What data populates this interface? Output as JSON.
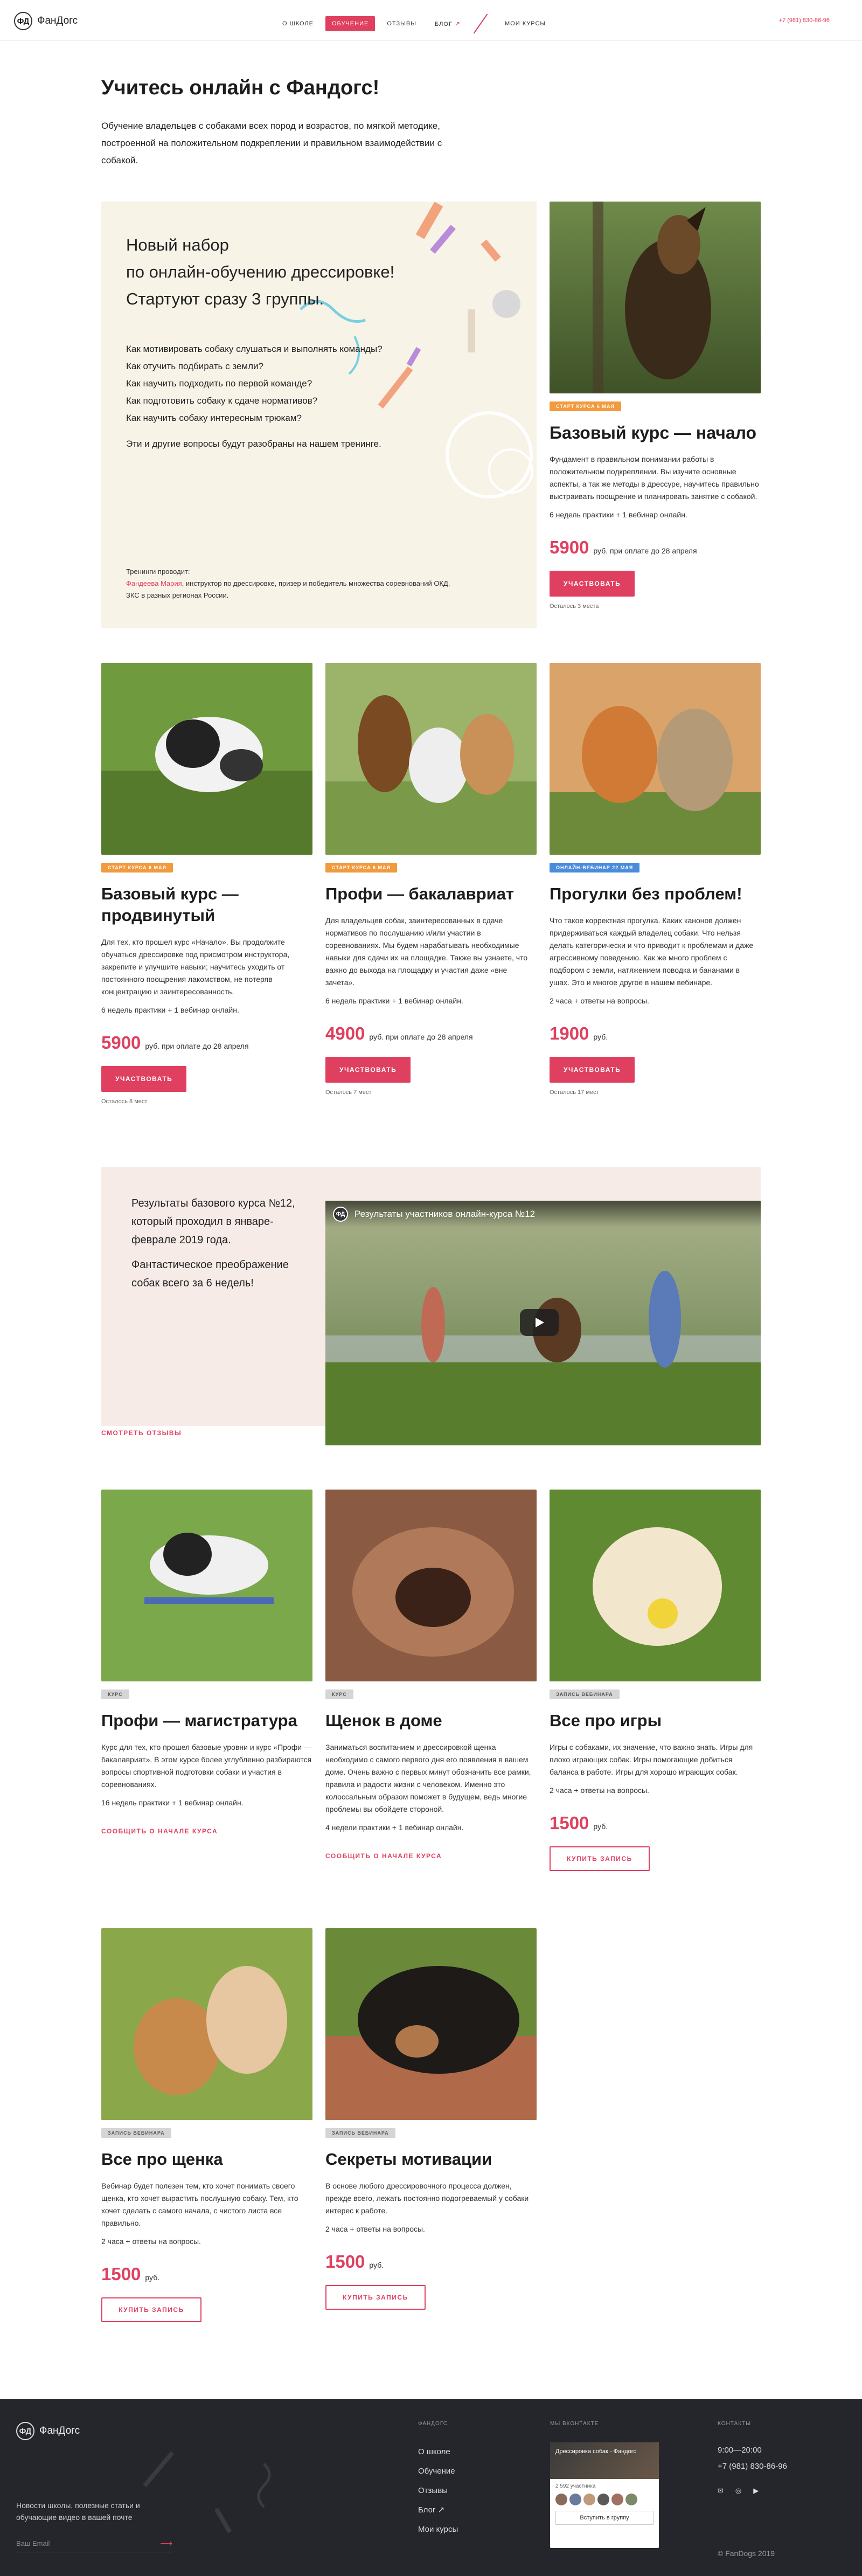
{
  "header": {
    "logo_mark": "ФД",
    "logo_text": "ФанДогс",
    "nav": [
      {
        "label": "О школе"
      },
      {
        "label": "Обучение"
      },
      {
        "label": "Отзывы"
      },
      {
        "label": "Блог"
      },
      {
        "label": "Мои курсы"
      }
    ],
    "blog_arrow": "↗",
    "phone": "+7 (981) 830-86-96"
  },
  "intro": {
    "title": "Учитесь онлайн с Фандогс!",
    "text": "Обучение владельцев с собаками всех пород и возрастов, по мягкой методике, построенной на положительном подкреплении и правильном взаимодействии с собакой."
  },
  "promo": {
    "headline_lines": [
      "Новый набор",
      "по онлайн-обучению дрессировке!",
      "Стартуют сразу 3 группы."
    ],
    "questions": [
      "Как мотивировать собаку слушаться и выполнять команды?",
      "Как отучить подбирать с земли?",
      "Как научить подходить по первой команде?",
      "Как подготовить собаку к сдаче нормативов?",
      "Как научить собаку интересным трюкам?"
    ],
    "closing": "Эти и другие вопросы будут разобраны на нашем тренинге.",
    "trainer_label": "Тренинги проводит:",
    "trainer_name": "Фандеева Мария",
    "trainer_desc": ", инструктор по дрессировке, призер и победитель множества соревнований ОКД, ЗКС в разных регионах России."
  },
  "featured": {
    "badge": "Старт курса 6 мая",
    "title": "Базовый курс — начало",
    "desc": "Фундамент в правильном понимании работы в положительном подкреплении. Вы изучите основные аспекты, а так же методы в дрессуре, научитесь правильно выстраивать поощрение и планировать занятие с собакой.",
    "meta": "6 недель практики + 1 вебинар онлайн.",
    "price": "5900",
    "price_unit": "руб. при оплате до 28 апреля",
    "button": "Участвовать",
    "left": "Осталось 3 места"
  },
  "row2": [
    {
      "badge": "Старт курса 6 мая",
      "title": "Базовый курс — продвинутый",
      "desc": "Для тех, кто прошел курс «Начало». Вы продолжите обучаться дрессировке под присмотром инструктора, закрепите и улучшите навыки; научитесь уходить от постоянного поощрения лакомством, не потеряв концентрацию и заинтересованность.",
      "meta": "6 недель практики + 1 вебинар онлайн.",
      "price": "5900",
      "price_unit": "руб. при оплате до 28 апреля",
      "button": "Участвовать",
      "left": "Осталось 8 мест"
    },
    {
      "badge": "Старт курса 6 мая",
      "title": "Профи — бакалавриат",
      "desc": "Для владельцев собак, заинтересованных в сдаче нормативов по послушанию и/или участии в соревнованиях. Мы будем нарабатывать необходимые навыки для сдачи их на площадке. Также вы узнаете, что важно до выхода на площадку и участия даже «вне зачета».",
      "meta": "6 недель практики + 1 вебинар онлайн.",
      "price": "4900",
      "price_unit": "руб. при оплате до 28 апреля",
      "button": "Участвовать",
      "left": "Осталось 7 мест"
    },
    {
      "badge": "Онлайн-вебинар 22 мая",
      "title": "Прогулки без проблем!",
      "desc": "Что такое корректная прогулка. Каких канонов должен придерживаться каждый владелец собаки. Что нельзя делать категорически и что приводит к проблемам и даже агрессивному поведению. Как же много проблем с подбором с земли, натяжением поводка и бананами в ушах. Это и многое другое в нашем вебинаре.",
      "meta": "2 часа + ответы на вопросы.",
      "price": "1900",
      "price_unit": "руб.",
      "button": "Участвовать",
      "left": "Осталось 17 мест"
    }
  ],
  "results": {
    "text": "Результаты базового курса №12, который проходил в январе-феврале 2019 года.",
    "sub": "Фантастическое преображение собак всего за 6 недель!",
    "link": "Смотреть отзывы",
    "video_title": "Результаты участников онлайн-курса №12"
  },
  "row3": [
    {
      "badge": "Курс",
      "title": "Профи — магистратура",
      "desc": "Курс для тех, кто прошел базовые уровни и курс «Профи — бакалавриат». В этом курсе более углубленно разбираются вопросы спортивной подготовки собаки и участия в соревнованиях.",
      "meta": "16 недель практики + 1 вебинар онлайн.",
      "link": "Сообщить о начале курса"
    },
    {
      "badge": "Курс",
      "title": "Щенок в доме",
      "desc": "Заниматься воспитанием и дрессировкой щенка необходимо с самого первого дня его появления в вашем доме. Очень важно с первых минут обозначить все рамки, правила и радости жизни с человеком. Именно это колоссальным образом поможет в будущем, ведь многие проблемы вы обойдете стороной.",
      "meta": "4 недели практики + 1 вебинар онлайн.",
      "link": "Сообщить о начале курса"
    },
    {
      "badge": "Запись вебинара",
      "title": "Все про игры",
      "desc": "Игры с собаками, их значение, что важно знать. Игры для плохо играющих собак. Игры помогающие добиться баланса в работе. Игры для хорошо играющих собак.",
      "meta": "2 часа + ответы на вопросы.",
      "price": "1500",
      "price_unit": "руб.",
      "button": "Купить запись"
    }
  ],
  "row4": [
    {
      "badge": "Запись вебинара",
      "title": "Все про щенка",
      "desc": "Вебинар будет полезен тем, кто хочет понимать своего щенка, кто хочет вырастить послушную собаку. Тем, кто хочет сделать с самого начала, с чистого листа все правильно.",
      "meta": "2 часа + ответы на вопросы.",
      "price": "1500",
      "price_unit": "руб.",
      "button": "Купить запись"
    },
    {
      "badge": "Запись вебинара",
      "title": "Секреты мотивации",
      "desc": "В основе любого дрессировочного процесса должен, прежде всего, лежать постоянно подогреваемый у собаки интерес к работе.",
      "meta": "2 часа + ответы на вопросы.",
      "price": "1500",
      "price_unit": "руб.",
      "button": "Купить запись"
    }
  ],
  "footer": {
    "logo_text": "ФанДогс",
    "news_text": "Новости школы, полезные статьи и обучающие видео в вашей почте",
    "email_placeholder": "Ваш Email",
    "email_arrow": "⟶",
    "col_school": "Фандогс",
    "links": [
      "О школе",
      "Обучение",
      "Отзывы",
      "Блог ↗",
      "Мои курсы"
    ],
    "col_vk": "Мы ВКонтакте",
    "vk_group": "Дрессировка собак - Фандогс",
    "vk_members": "2 592 участника",
    "vk_join": "Вступить в группу",
    "col_contacts": "Контакты",
    "hours": "9:00—20:00",
    "phone": "+7 (981) 830-86-96",
    "social": [
      "✉",
      "◎",
      "▶"
    ],
    "copyright": "© FanDogs 2019"
  },
  "colors": {
    "accent": "#e04060",
    "badge_orange": "#f19a3e",
    "badge_blue": "#4a8cdc",
    "footer_bg": "#25262b"
  }
}
